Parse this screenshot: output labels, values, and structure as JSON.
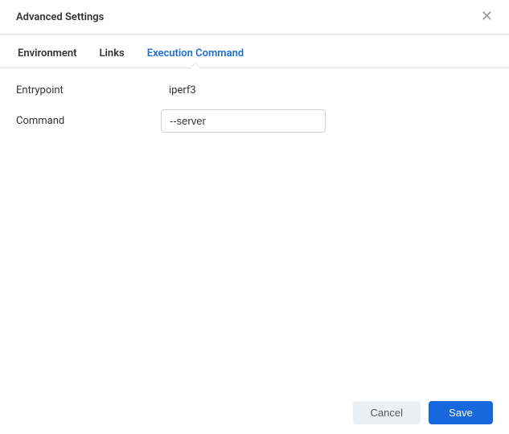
{
  "header": {
    "title": "Advanced Settings"
  },
  "tabs": {
    "environment": "Environment",
    "links": "Links",
    "execution_command": "Execution Command"
  },
  "form": {
    "entrypoint_label": "Entrypoint",
    "entrypoint_value": "iperf3",
    "command_label": "Command",
    "command_value": "--server"
  },
  "footer": {
    "cancel_label": "Cancel",
    "save_label": "Save"
  }
}
